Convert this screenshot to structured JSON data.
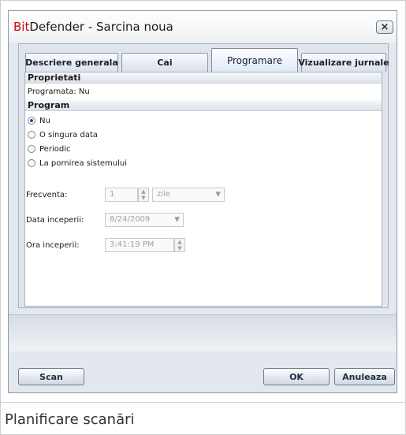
{
  "window": {
    "title_brand_red": "Bit",
    "title_brand_rest": "Defender",
    "title_sep": " - ",
    "title_rest": "Sarcina noua",
    "close_glyph": "×"
  },
  "tabs": [
    {
      "label": "Descriere generala",
      "active": false
    },
    {
      "label": "Cai",
      "active": false
    },
    {
      "label": "Programare",
      "active": true
    },
    {
      "label": "Vizualizare jurnale",
      "active": false
    }
  ],
  "properties": {
    "header": "Proprietati",
    "scheduled_text": "Programata:  Nu"
  },
  "program": {
    "header": "Program",
    "options": [
      {
        "label": "Nu",
        "checked": true
      },
      {
        "label": "O singura data",
        "checked": false
      },
      {
        "label": "Periodic",
        "checked": false
      },
      {
        "label": "La pornirea sistemului",
        "checked": false
      }
    ]
  },
  "fields": {
    "frequency_label": "Frecventa:",
    "frequency_value": "1",
    "frequency_unit": "zile",
    "start_date_label": "Data inceperii:",
    "start_date_value": "8/24/2009",
    "start_time_label": "Ora inceperii:",
    "start_time_value": "3:41:19 PM"
  },
  "buttons": {
    "scan": "Scan",
    "ok": "OK",
    "cancel": "Anuleaza"
  },
  "caption": "Planificare scanări",
  "colors": {
    "brand_red": "#d10a0a",
    "radio_checked": "#1f4f94"
  },
  "icons": {
    "close": "close-icon",
    "spinner_up": "chevron-up-icon",
    "spinner_down": "chevron-down-icon",
    "dropdown": "chevron-down-icon"
  }
}
